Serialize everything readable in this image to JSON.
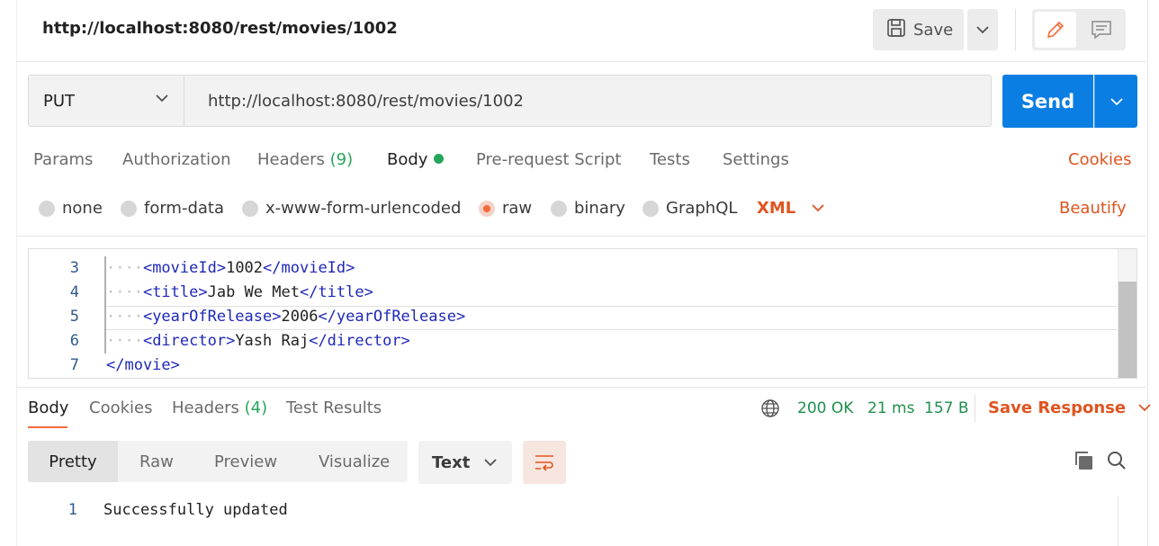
{
  "header": {
    "request_name": "http://localhost:8080/rest/movies/1002",
    "save_label": "Save"
  },
  "request": {
    "method": "PUT",
    "url": "http://localhost:8080/rest/movies/1002",
    "send_label": "Send"
  },
  "request_tabs": {
    "params": "Params",
    "authorization": "Authorization",
    "headers": "Headers",
    "headers_count": "(9)",
    "body": "Body",
    "pre_request": "Pre-request Script",
    "tests": "Tests",
    "settings": "Settings",
    "cookies": "Cookies"
  },
  "body_types": {
    "none": "none",
    "form_data": "form-data",
    "urlencoded": "x-www-form-urlencoded",
    "raw": "raw",
    "binary": "binary",
    "graphql": "GraphQL",
    "selected": "raw",
    "format": "XML",
    "beautify": "Beautify"
  },
  "editor": {
    "lines": [
      {
        "num": "3",
        "indent": "····",
        "open": "<movieId>",
        "text": "1002",
        "close": "</movieId>"
      },
      {
        "num": "4",
        "indent": "····",
        "open": "<title>",
        "text": "Jab We Met",
        "close": "</title>"
      },
      {
        "num": "5",
        "indent": "····",
        "open": "<yearOfRelease>",
        "text": "2006",
        "close": "</yearOfRelease>"
      },
      {
        "num": "6",
        "indent": "····",
        "open": "<director>",
        "text": "Yash Raj",
        "close": "</director>"
      },
      {
        "num": "7",
        "indent": "",
        "open": "",
        "text": "",
        "close": "</movie>"
      }
    ]
  },
  "response": {
    "tabs": {
      "body": "Body",
      "cookies": "Cookies",
      "headers": "Headers",
      "headers_count": "(4)",
      "test_results": "Test Results"
    },
    "status": "200 OK",
    "time": "21 ms",
    "size": "157 B",
    "save_response": "Save Response",
    "formats": {
      "pretty": "Pretty",
      "raw": "Raw",
      "preview": "Preview",
      "visualize": "Visualize"
    },
    "content_type": "Text",
    "line_number": "1",
    "content": "Successfully updated"
  },
  "colors": {
    "accent": "#e0541f",
    "send": "#0b7ee3",
    "success": "#26a65b",
    "xml_tag": "#1f28b8"
  },
  "icons": [
    "save-icon",
    "chevron-down-icon",
    "pencil-icon",
    "comment-icon",
    "globe-icon",
    "wrap-lines-icon",
    "copy-icon",
    "search-icon"
  ]
}
